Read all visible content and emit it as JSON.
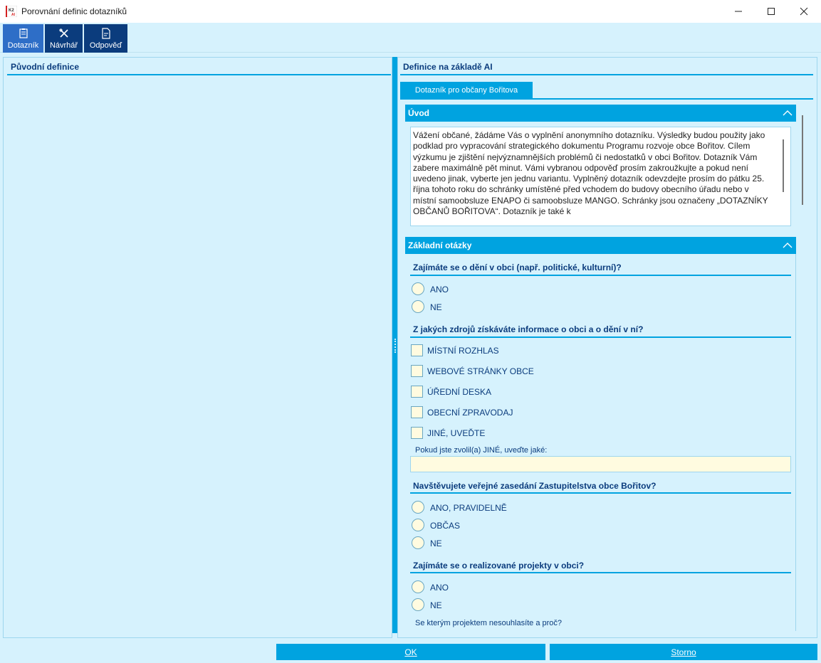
{
  "window": {
    "title": "Porovnání definic dotazníků",
    "icon": "k2-app-icon",
    "controls": [
      "minimize-icon",
      "maximize-icon",
      "close-icon"
    ]
  },
  "toolbar": {
    "buttons": [
      {
        "label": "Dotazník",
        "icon": "questionnaire-icon",
        "active": true
      },
      {
        "label": "Návrhář",
        "icon": "tools-icon",
        "active": false
      },
      {
        "label": "Odpověď",
        "icon": "answer-document-icon",
        "active": false
      }
    ]
  },
  "left_pane": {
    "title": "Původní definice"
  },
  "right_pane": {
    "title": "Definice na základě AI",
    "tab": "Dotazník pro občany Bořitova",
    "intro_section": {
      "title": "Úvod",
      "text": "Vážení občané, žádáme Vás o vyplnění anonymního dotazníku. Výsledky budou použity jako podklad pro vypracování strategického dokumentu Programu rozvoje obce Bořitov. Cílem výzkumu je zjištění nejvýznamnějších problémů či nedostatků v obci Bořitov. Dotazník Vám zabere maximálně pět minut. Vámi vybranou odpověď prosím zakroužkujte a pokud není uvedeno jinak, vyberte jen jednu variantu. Vyplněný dotazník odevzdejte prosím do pátku 25. října tohoto roku do schránky umístěné před vchodem do budovy obecního úřadu nebo v místní samoobsluze ENAPO či samoobsluze MANGO. Schránky jsou označeny „DOTAZNÍKY OBČANŮ BOŘITOVA“. Dotazník je také k"
    },
    "basic_section": {
      "title": "Základní otázky",
      "q1": {
        "text": "Zajímáte se o dění v obci (např. politické, kulturní)?",
        "options": [
          "ANO",
          "NE"
        ]
      },
      "q2": {
        "text": "Z jakých zdrojů získáváte informace o obci a o dění v ní?",
        "options": [
          "MÍSTNÍ ROZHLAS",
          "WEBOVÉ STRÁNKY OBCE",
          "ÚŘEDNÍ DESKA",
          "OBECNÍ ZPRAVODAJ",
          "JINÉ, UVEĎTE"
        ],
        "other_label": "Pokud jste zvolil(a) JINÉ, uveďte jaké:",
        "other_value": ""
      },
      "q3": {
        "text": "Navštěvujete veřejné zasedání Zastupitelstva obce Bořitov?",
        "options": [
          "ANO, PRAVIDELNĚ",
          "OBČAS",
          "NE"
        ]
      },
      "q4": {
        "text": "Zajímáte se o realizované projekty v obci?",
        "options": [
          "ANO",
          "NE"
        ],
        "followup_label": "Se kterým projektem nesouhlasíte a proč?"
      }
    }
  },
  "footer": {
    "ok_label": "OK",
    "cancel_label": "Storno"
  },
  "colors": {
    "accent": "#00a3e0",
    "background": "#d6f2fd",
    "toolbar_dark": "#0b3c7d",
    "toolbar_active": "#2e6ec7",
    "field_fill": "#fffbe0"
  }
}
